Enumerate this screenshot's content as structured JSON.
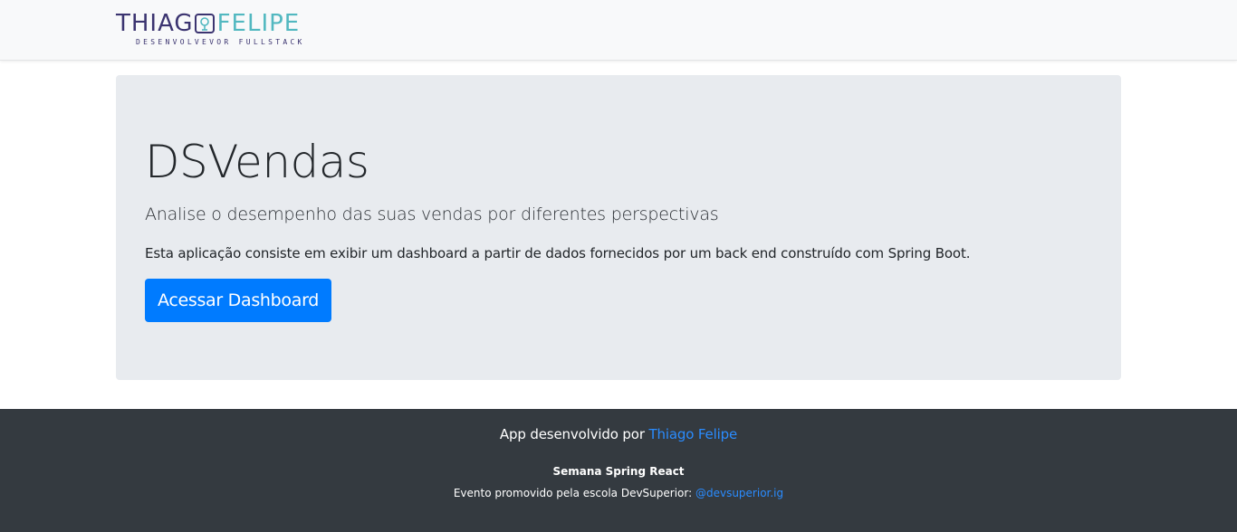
{
  "navbar": {
    "logo_first": "THIAG",
    "logo_last": "FELIPE",
    "logo_subtitle": "DESENVOLVEVOR FULLSTACK"
  },
  "jumbotron": {
    "title": "DSVendas",
    "lead": "Analise o desempenho das suas vendas por diferentes perspectivas",
    "text": "Esta aplicação consiste em exibir um dashboard a partir de dados fornecidos por um back end construído com Spring Boot.",
    "button_label": "Acessar Dashboard"
  },
  "footer": {
    "developed_by_prefix": "App desenvolvido por ",
    "developer_link": "Thiago Felipe",
    "event_title": "Semana Spring React",
    "event_text_prefix": "Evento promovido pela escola DevSuperior: ",
    "event_link": "@devsuperior.ig"
  },
  "colors": {
    "primary": "#007bff",
    "footer_bg": "#343a40",
    "jumbotron_bg": "#e8ebef",
    "logo_purple": "#3b3470",
    "logo_teal": "#52b8c0"
  }
}
